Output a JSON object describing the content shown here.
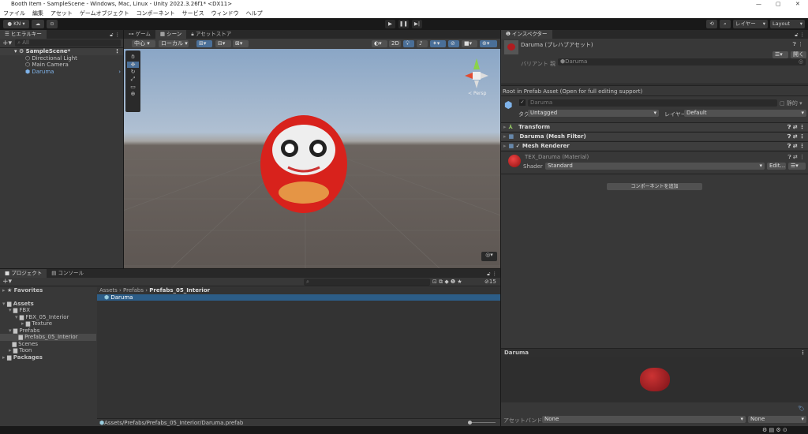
{
  "window": {
    "title": "Booth Item - SampleScene - Windows, Mac, Linux - Unity 2022.3.26f1* <DX11>"
  },
  "menu": [
    "ファイル",
    "編集",
    "アセット",
    "ゲームオブジェクト",
    "コンポーネント",
    "サービス",
    "ウィンドウ",
    "ヘルプ"
  ],
  "toolbar": {
    "account": "KN",
    "layers": "レイヤー",
    "layout": "Layout"
  },
  "hierarchy": {
    "tab": "ヒエラルキー",
    "search_placeholder": "All",
    "scene": "SampleScene*",
    "items": [
      "Directional Light",
      "Main Camera",
      "Daruma"
    ]
  },
  "scene": {
    "tabs": [
      "ゲーム",
      "シーン",
      "アセットストア"
    ],
    "pivot": "中心",
    "space": "ローカル",
    "mode_2d": "2D",
    "persp": "Persp"
  },
  "inspector": {
    "tab": "インスペクター",
    "asset_title": "Daruma (プレハブアセット)",
    "open_button": "開く",
    "variant_label": "バリアント 親",
    "variant_value": "Daruma",
    "root_message": "Root in Prefab Asset (Open for full editing support)",
    "object_name": "Daruma",
    "static_label": "静的",
    "tag_label": "タグ",
    "tag_value": "Untagged",
    "layer_label": "レイヤー",
    "layer_value": "Default",
    "components": [
      "Transform",
      "Daruma (Mesh Filter)",
      "Mesh Renderer"
    ],
    "material": {
      "name": "TEX_Daruma (Material)",
      "shader_label": "Shader",
      "shader_value": "Standard",
      "edit_button": "Edit..."
    },
    "add_component": "コンポーネントを追加",
    "preview_title": "Daruma",
    "asset_bundle_label": "アセットバンドル",
    "bundle_value": "None",
    "variant_bundle": "None"
  },
  "project": {
    "tabs": [
      "プロジェクト",
      "コンソール"
    ],
    "hidden_count": "15",
    "tree": [
      {
        "label": "Favorites",
        "indent": 0
      },
      {
        "label": "Assets",
        "indent": 0
      },
      {
        "label": "FBX",
        "indent": 1
      },
      {
        "label": "FBX_05_Interior",
        "indent": 2
      },
      {
        "label": "Texture",
        "indent": 3
      },
      {
        "label": "Prefabs",
        "indent": 1
      },
      {
        "label": "Prefabs_05_Interior",
        "indent": 2
      },
      {
        "label": "Scenes",
        "indent": 1
      },
      {
        "label": "Toon",
        "indent": 1
      },
      {
        "label": "Packages",
        "indent": 0
      }
    ],
    "breadcrumb": [
      "Assets",
      "Prefabs",
      "Prefabs_05_Interior"
    ],
    "files": [
      "Daruma"
    ],
    "path": "Assets/Prefabs/Prefabs_05_Interior/Daruma.prefab"
  },
  "colors": {
    "selection": "#2c5d87",
    "daruma_red": "#d8221c",
    "sky": "#8fa9c7",
    "ground": "#5e5753"
  }
}
